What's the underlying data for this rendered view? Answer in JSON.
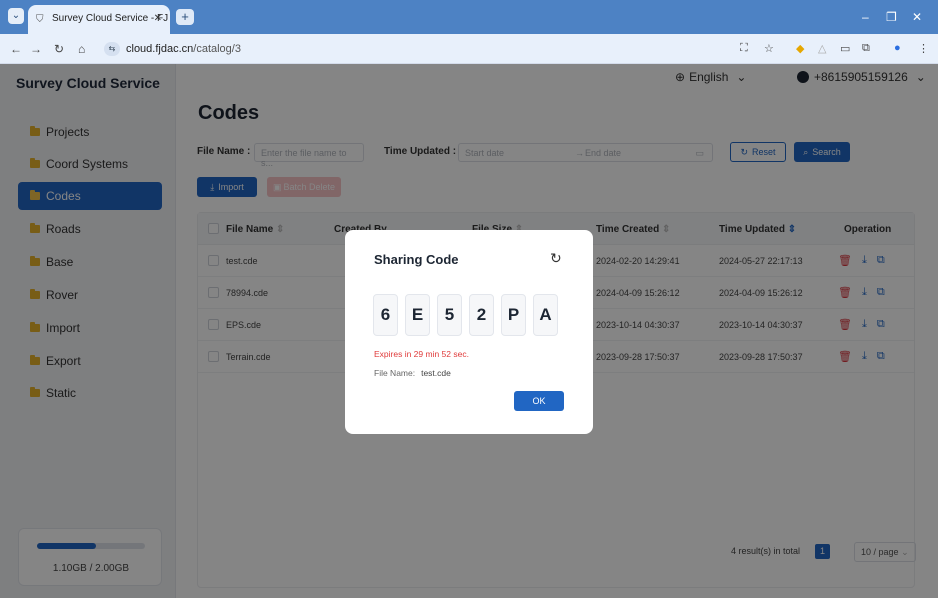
{
  "browser": {
    "tab_title": "Survey Cloud Service - FJ Cl",
    "url_domain": "cloud.fjdac.cn",
    "url_path": "/catalog/3"
  },
  "app": {
    "brand": "Survey Cloud Service",
    "language": "English",
    "user_phone": "+8615905159126"
  },
  "sidebar": {
    "items": [
      {
        "label": "Projects"
      },
      {
        "label": "Coord Systems"
      },
      {
        "label": "Codes"
      },
      {
        "label": "Roads"
      },
      {
        "label": "Base"
      },
      {
        "label": "Rover"
      },
      {
        "label": "Import"
      },
      {
        "label": "Export"
      },
      {
        "label": "Static"
      }
    ],
    "active_index": 2,
    "storage": {
      "text": "1.10GB / 2.00GB",
      "used_fraction": 0.55
    }
  },
  "page": {
    "title": "Codes",
    "filters": {
      "file_name_label": "File Name :",
      "file_name_placeholder": "Enter the file name to s...",
      "time_updated_label": "Time Updated :",
      "start_placeholder": "Start date",
      "end_placeholder": "End date",
      "range_arrow": "→"
    },
    "buttons": {
      "reset": "Reset",
      "search": "Search",
      "import": "Import",
      "batch_delete": "Batch Delete"
    }
  },
  "table": {
    "headers": {
      "file_name": "File Name",
      "created_by": "Created By",
      "file_size": "File Size",
      "time_created": "Time Created",
      "time_updated": "Time Updated",
      "operation": "Operation"
    },
    "rows": [
      {
        "file_name": "test.cde",
        "time_created": "2024-02-20 14:29:41",
        "time_updated": "2024-05-27 22:17:13"
      },
      {
        "file_name": "78994.cde",
        "time_created": "2024-04-09 15:26:12",
        "time_updated": "2024-04-09 15:26:12"
      },
      {
        "file_name": "EPS.cde",
        "time_created": "2023-10-14 04:30:37",
        "time_updated": "2023-10-14 04:30:37"
      },
      {
        "file_name": "Terrain.cde",
        "time_created": "2023-09-28 17:50:37",
        "time_updated": "2023-09-28 17:50:37"
      }
    ]
  },
  "pagination": {
    "total_text": "4 result(s) in total",
    "current_page": "1",
    "page_size": "10 / page"
  },
  "modal": {
    "title": "Sharing Code",
    "code_chars": [
      "6",
      "E",
      "5",
      "2",
      "P",
      "A"
    ],
    "expires_text": "Expires in 29 min 52 sec.",
    "file_label": "File Name:",
    "file_value": "test.cde",
    "ok": "OK"
  },
  "colors": {
    "primary": "#2166c3",
    "danger": "#e03b3b",
    "browser_chrome": "#4d82c4",
    "folder": "#e6b22b"
  }
}
